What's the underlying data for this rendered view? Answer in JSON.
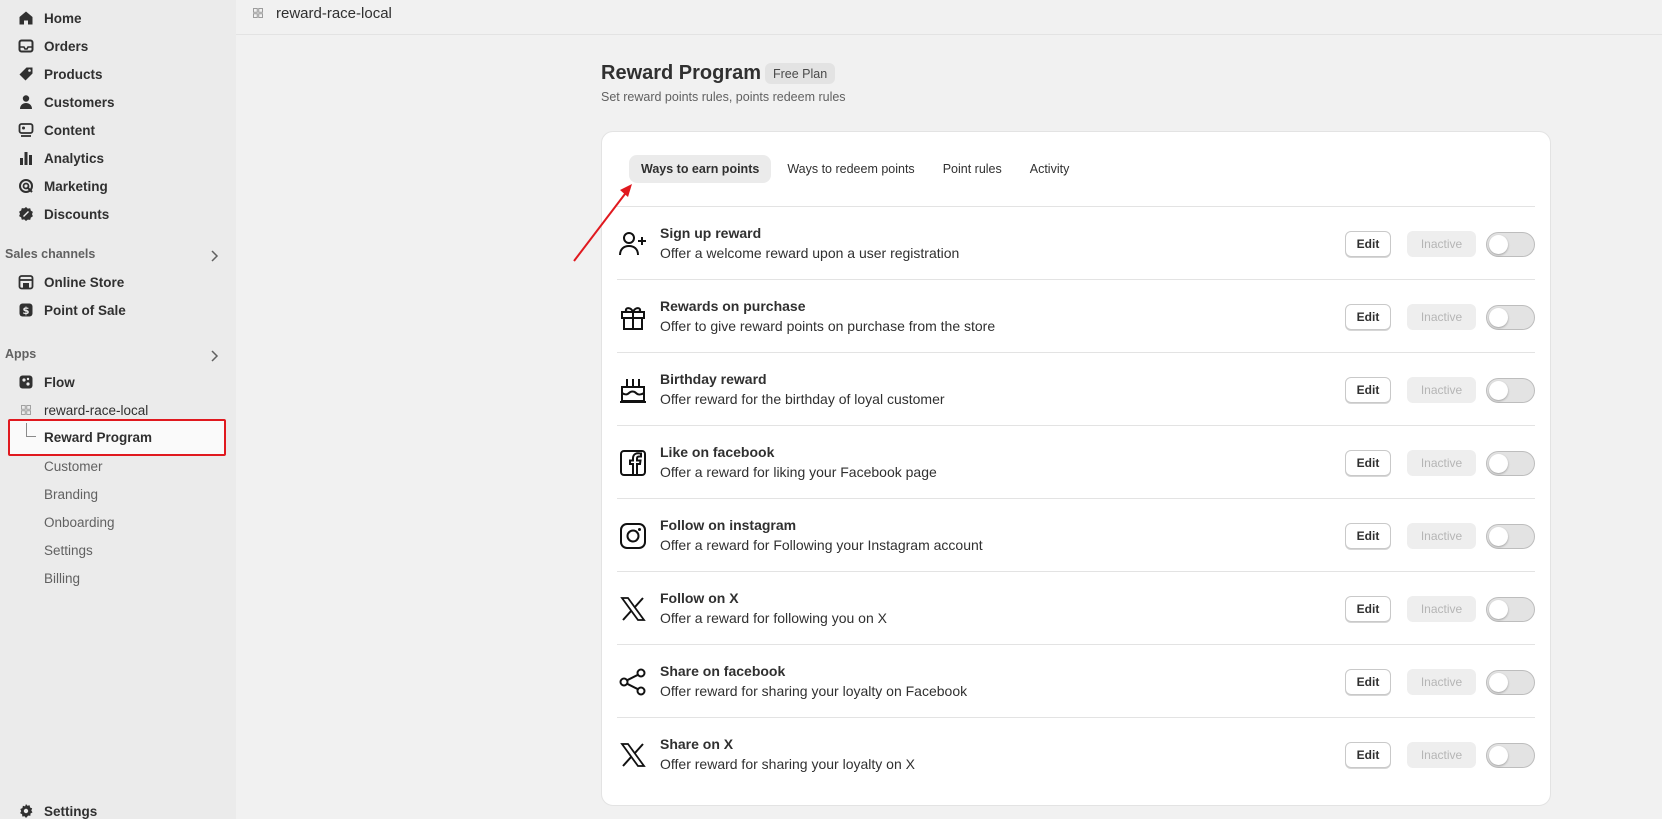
{
  "topbar": {
    "app_name": "reward-race-local"
  },
  "sidebar": {
    "nav": [
      {
        "label": "Home",
        "icon": "home-icon"
      },
      {
        "label": "Orders",
        "icon": "inbox-icon"
      },
      {
        "label": "Products",
        "icon": "tag-icon"
      },
      {
        "label": "Customers",
        "icon": "person-icon"
      },
      {
        "label": "Content",
        "icon": "content-icon"
      },
      {
        "label": "Analytics",
        "icon": "bar-chart-icon"
      },
      {
        "label": "Marketing",
        "icon": "target-icon"
      },
      {
        "label": "Discounts",
        "icon": "discount-icon"
      }
    ],
    "sales_channels_title": "Sales channels",
    "sales_channels": [
      {
        "label": "Online Store",
        "icon": "store-icon"
      },
      {
        "label": "Point of Sale",
        "icon": "pos-icon"
      }
    ],
    "apps_title": "Apps",
    "apps": [
      {
        "label": "Flow",
        "icon": "flow-icon"
      },
      {
        "label": "reward-race-local",
        "icon": "app-grid-icon"
      }
    ],
    "reward_program_label": "Reward Program",
    "sub_items": [
      "Customer",
      "Branding",
      "Onboarding",
      "Settings",
      "Billing"
    ],
    "settings_label": "Settings"
  },
  "page": {
    "title": "Reward Program",
    "badge": "Free Plan",
    "subtitle": "Set reward points rules, points redeem rules"
  },
  "tabs": [
    {
      "label": "Ways to earn points",
      "active": true
    },
    {
      "label": "Ways to redeem points",
      "active": false
    },
    {
      "label": "Point rules",
      "active": false
    },
    {
      "label": "Activity",
      "active": false
    }
  ],
  "rows": [
    {
      "title": "Sign up reward",
      "desc": "Offer a welcome reward upon a user registration",
      "icon": "user-plus-icon",
      "edit": "Edit",
      "status": "Inactive"
    },
    {
      "title": "Rewards on purchase",
      "desc": "Offer to give reward points on purchase from the store",
      "icon": "gift-icon",
      "edit": "Edit",
      "status": "Inactive"
    },
    {
      "title": "Birthday reward",
      "desc": "Offer reward for the birthday of loyal customer",
      "icon": "cake-icon",
      "edit": "Edit",
      "status": "Inactive"
    },
    {
      "title": "Like on facebook",
      "desc": "Offer a reward for liking your Facebook page",
      "icon": "facebook-icon",
      "edit": "Edit",
      "status": "Inactive"
    },
    {
      "title": "Follow on instagram",
      "desc": "Offer a reward for Following your Instagram account",
      "icon": "instagram-icon",
      "edit": "Edit",
      "status": "Inactive"
    },
    {
      "title": "Follow on X",
      "desc": "Offer a reward for following you on X",
      "icon": "x-logo-icon",
      "edit": "Edit",
      "status": "Inactive"
    },
    {
      "title": "Share on facebook",
      "desc": "Offer reward for sharing your loyalty on Facebook",
      "icon": "share-icon",
      "edit": "Edit",
      "status": "Inactive"
    },
    {
      "title": "Share on X",
      "desc": "Offer reward for sharing your loyalty on X",
      "icon": "x-logo-icon",
      "edit": "Edit",
      "status": "Inactive"
    }
  ],
  "colors": {
    "highlight": "#e0191f",
    "annotation_arrow": "#e0191f"
  }
}
